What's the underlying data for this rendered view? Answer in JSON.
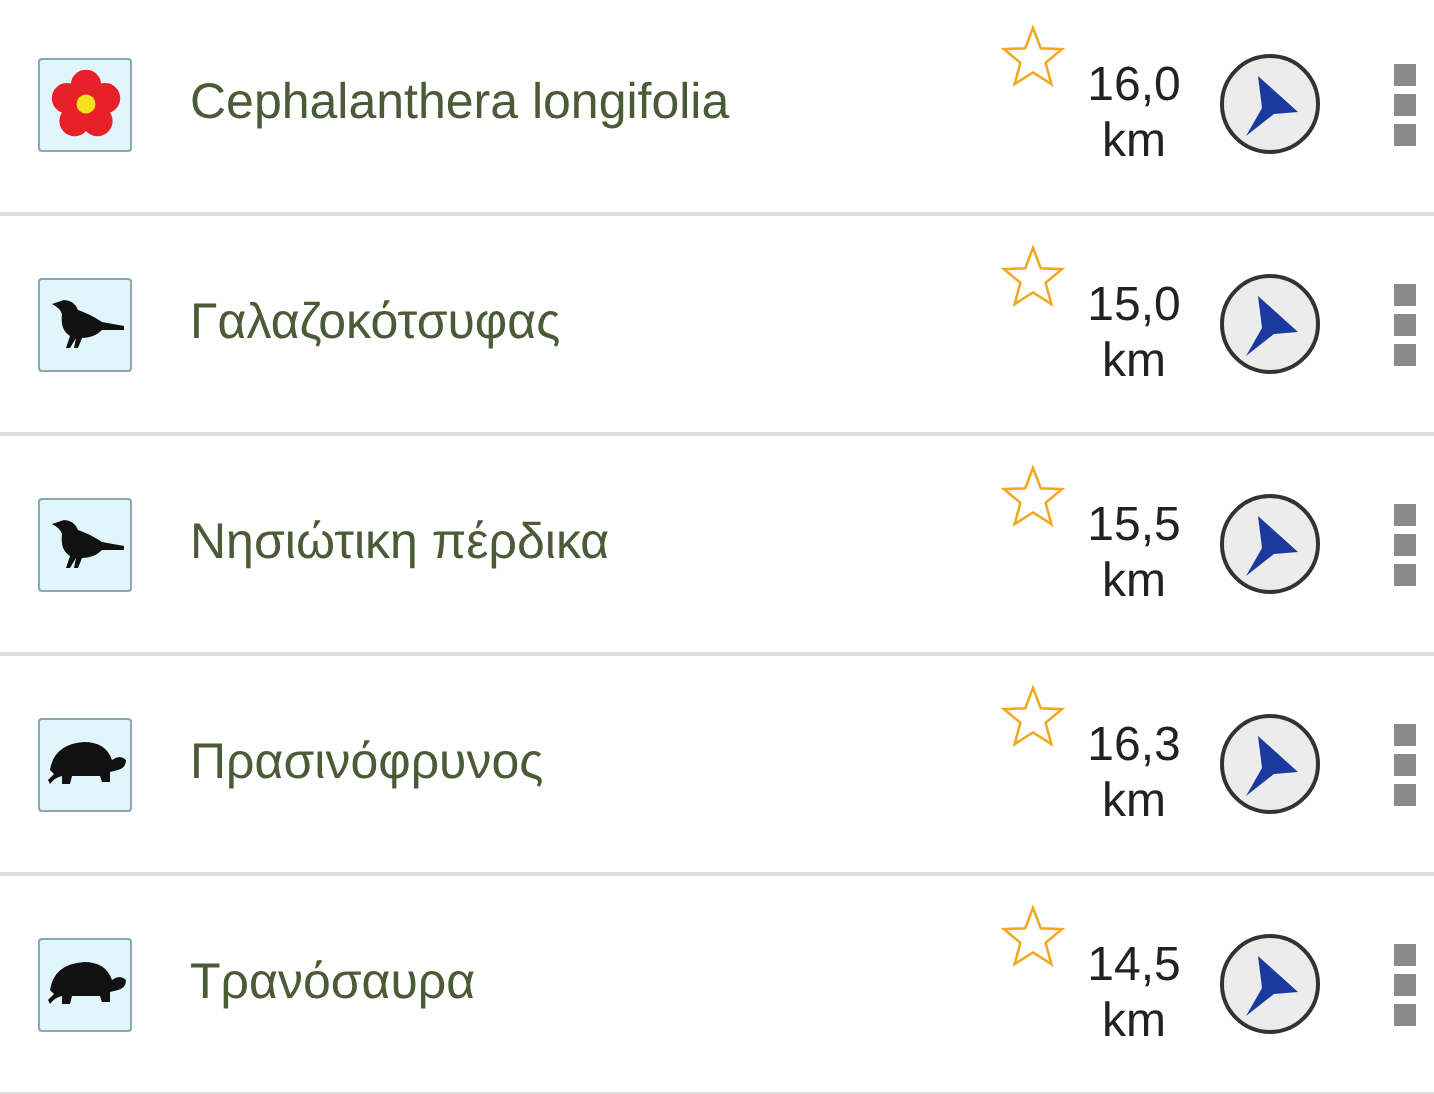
{
  "items": [
    {
      "kind": "flower",
      "name": "Cephalanthera longifolia",
      "favorite": false,
      "distance": "16,0",
      "unit": "km"
    },
    {
      "kind": "bird",
      "name": "Γαλαζοκότσυφας",
      "favorite": false,
      "distance": "15,0",
      "unit": "km"
    },
    {
      "kind": "bird",
      "name": "Νησιώτικη πέρδικα",
      "favorite": false,
      "distance": "15,5",
      "unit": "km"
    },
    {
      "kind": "turtle",
      "name": "Πρασινόφρυνος",
      "favorite": false,
      "distance": "16,3",
      "unit": "km"
    },
    {
      "kind": "turtle",
      "name": "Τρανόσαυρα",
      "favorite": false,
      "distance": "14,5",
      "unit": "km"
    }
  ]
}
